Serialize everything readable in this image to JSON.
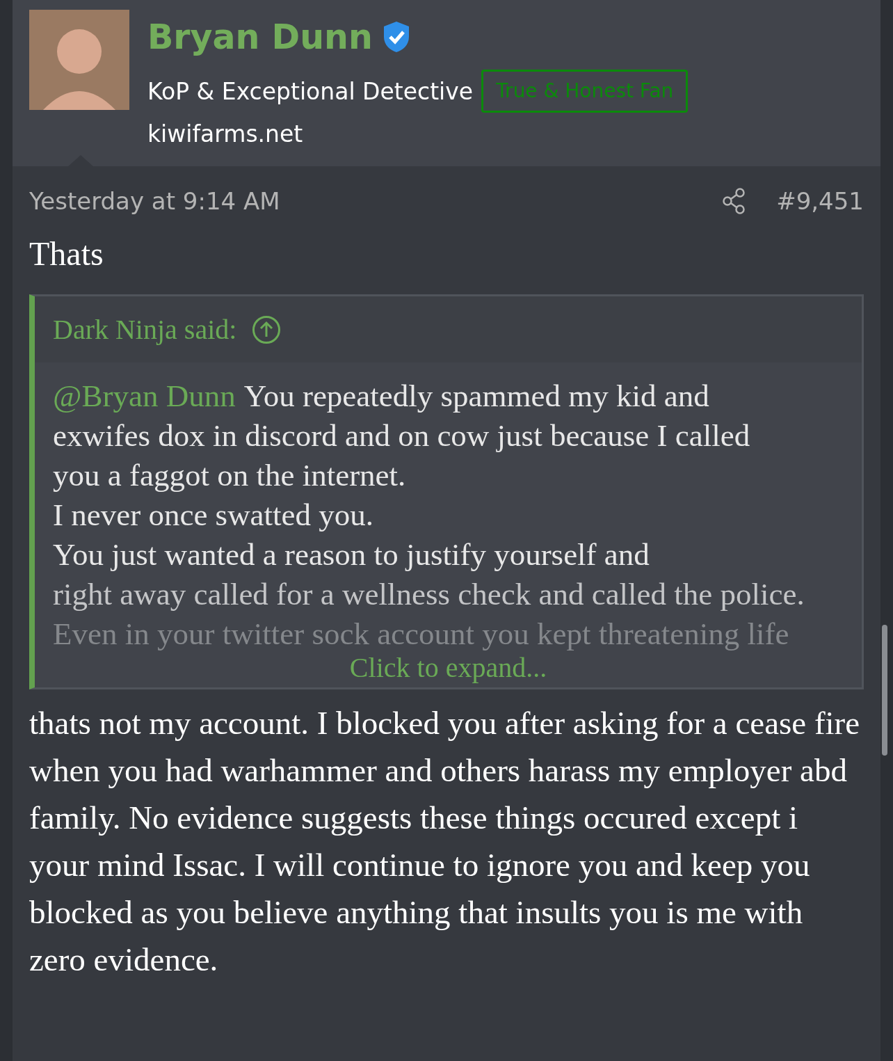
{
  "user": {
    "name": "Bryan Dunn",
    "verified": true,
    "title": "KoP & Exceptional Detective",
    "badge": "True & Honest Fan",
    "site": "kiwifarms.net"
  },
  "post": {
    "time": "Yesterday at 9:14 AM",
    "number": "#9,451",
    "intro": "Thats",
    "quote": {
      "author": "Dark Ninja said:",
      "mention": "@Bryan Dunn",
      "lines": [
        "You repeatedly spammed my kid and",
        "exwifes dox in discord and on cow just because I called",
        "you a faggot on the internet.",
        "I never once swatted you.",
        "You just wanted a reason to justify yourself and",
        "right away called for a wellness check and called the police.",
        "Even in your twitter sock account you kept threatening life"
      ],
      "expand": "Click to expand..."
    },
    "body": "thats not my account. I blocked you after asking for a cease fire when you had warhammer and others harass my employer abd family. No evidence suggests these things occured except i your mind Issac. I will continue to ignore you and keep you blocked as you believe anything that insults you is me with zero evidence."
  }
}
